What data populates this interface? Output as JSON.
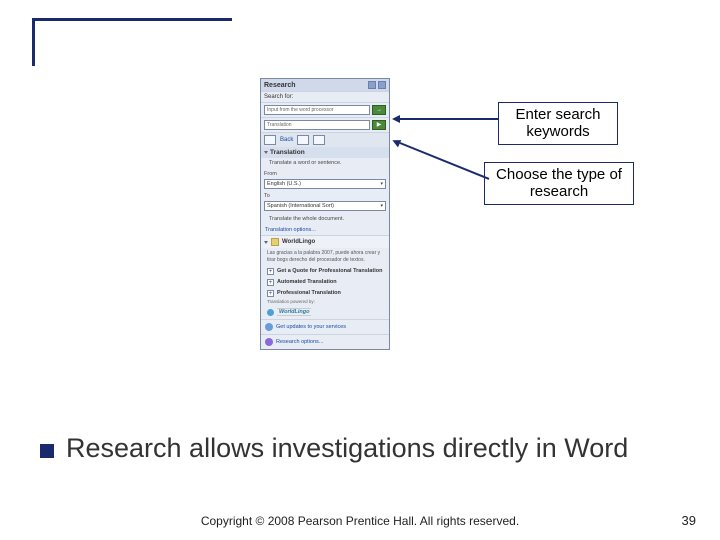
{
  "callouts": {
    "search": {
      "line1": "Enter search",
      "line2": "keywords"
    },
    "type": {
      "line1": "Choose the type of",
      "line2": "research"
    }
  },
  "pane": {
    "title": "Research",
    "searchLabel": "Search for:",
    "searchValue": "Input from the word processor",
    "typeValue": "Translation",
    "backLabel": "Back",
    "section": "Translation",
    "desc": "Translate a word or sentence.",
    "fromLabel": "From",
    "fromValue": "English (U.S.)",
    "toLabel": "To",
    "toValue": "Spanish (International Sort)",
    "wholeDoc": "Translate the whole document.",
    "optionsLink": "Translation options...",
    "subhead": "WorldLingo",
    "blurb": "Las gracias a la palabra 2007, puede ahora crear y tirar bogs derecho del procesador de textos.",
    "items": [
      "Get a Quote for Professional Translation",
      "Automated Translation",
      "Professional Translation"
    ],
    "poweredBy": "Translation powered by:",
    "brand": "WorldLingo",
    "footer1": "Get updates to your services",
    "footer2": "Research options..."
  },
  "bullet": "Research allows investigations directly in Word",
  "copyright": "Copyright © 2008 Pearson Prentice Hall. All rights reserved.",
  "page": "39"
}
